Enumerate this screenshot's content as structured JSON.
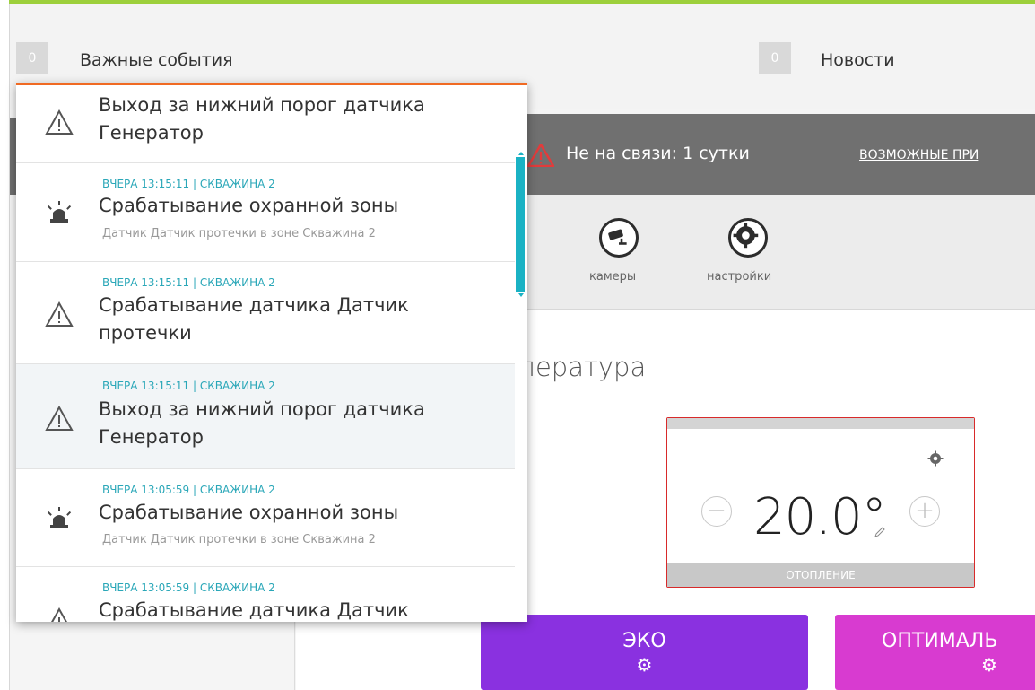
{
  "topbar": {
    "events_count": "0",
    "events_label": "Важные события",
    "news_count": "0",
    "news_label": "Новости"
  },
  "status": {
    "offline_text": "Не на связи:  1 сутки",
    "link_label": "ВОЗМОЖНЫЕ ПРИ"
  },
  "tools": [
    {
      "label": "камеры",
      "icon": "camera-icon"
    },
    {
      "label": "настройки",
      "icon": "gear-icon"
    }
  ],
  "temperature": {
    "title": "пература",
    "value": "20.0°",
    "mode_label": "ОТОПЛЕНИЕ",
    "minus": "−",
    "plus": "+",
    "settings_icon": "gear-icon",
    "edit_icon": "pencil-icon"
  },
  "modes": [
    {
      "label": "ЭКО",
      "color": "#8a31e0"
    },
    {
      "label": "ОПТИМАЛЬ",
      "color": "#d83bd0"
    }
  ],
  "events": [
    {
      "meta": "",
      "title": "Выход за нижний порог датчика Генератор",
      "sub": "",
      "icon": "warning-icon"
    },
    {
      "meta": "ВЧЕРА 13:15:11   |   СКВАЖИНА 2",
      "title": "Срабатывание охранной зоны",
      "sub": "Датчик Датчик протечки в зоне Скважина 2",
      "icon": "alarm-light-icon"
    },
    {
      "meta": "ВЧЕРА 13:15:11   |   СКВАЖИНА 2",
      "title": "Срабатывание датчика Датчик протечки",
      "sub": "",
      "icon": "warning-icon"
    },
    {
      "meta": "ВЧЕРА 13:15:11   |   СКВАЖИНА 2",
      "title": "Выход за нижний порог датчика Генератор",
      "sub": "",
      "icon": "warning-icon"
    },
    {
      "meta": "ВЧЕРА 13:05:59   |   СКВАЖИНА 2",
      "title": "Срабатывание охранной зоны",
      "sub": "Датчик Датчик протечки в зоне Скважина 2",
      "icon": "alarm-light-icon"
    },
    {
      "meta": "ВЧЕРА 13:05:59   |   СКВАЖИНА 2",
      "title": "Срабатывание датчика Датчик",
      "sub": "",
      "icon": "warning-icon"
    }
  ],
  "colors": {
    "accent_green": "#9ccf3b",
    "dropdown_border": "#f06a23",
    "meta_teal": "#2aa7b8",
    "alert_red": "#d82a2a"
  }
}
